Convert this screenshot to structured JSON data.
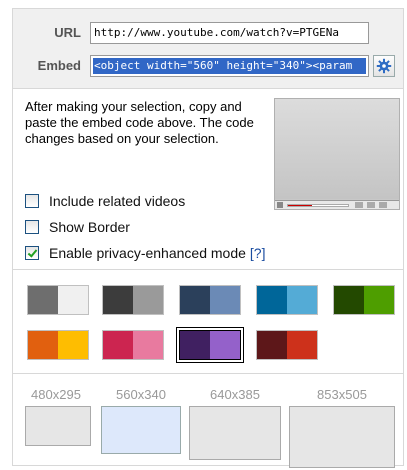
{
  "top": {
    "url_label": "URL",
    "url_value": "http://www.youtube.com/watch?v=PTGENa",
    "embed_label": "Embed",
    "embed_value": "<object width=\"560\" height=\"340\"><param"
  },
  "gear_icon": "gear-icon",
  "description": "After making your selection, copy and paste the embed code above. The code changes based on your selection.",
  "options": {
    "related": {
      "label": "Include related videos",
      "checked": false
    },
    "border": {
      "label": "Show Border",
      "checked": false
    },
    "privacy": {
      "label": "Enable privacy-enhanced mode",
      "help": "[?]",
      "checked": true
    }
  },
  "color_schemes": [
    {
      "left": "#6e6e6e",
      "right": "#f0f0f0",
      "selected": false
    },
    {
      "left": "#3c3c3c",
      "right": "#9a9a9a",
      "selected": false
    },
    {
      "left": "#2b405b",
      "right": "#6b8ab6",
      "selected": false
    },
    {
      "left": "#006699",
      "right": "#54abd6",
      "selected": false
    },
    {
      "left": "#234900",
      "right": "#4e9e00",
      "selected": false
    },
    {
      "left": "#e1600f",
      "right": "#febd01",
      "selected": false
    },
    {
      "left": "#cc2550",
      "right": "#e87a9f",
      "selected": false
    },
    {
      "left": "#402061",
      "right": "#9461ca",
      "selected": true
    },
    {
      "left": "#5d1719",
      "right": "#cd311b",
      "selected": false
    }
  ],
  "sizes": [
    {
      "label": "480x295",
      "selected": false
    },
    {
      "label": "560x340",
      "selected": true
    },
    {
      "label": "640x385",
      "selected": false
    },
    {
      "label": "853x505",
      "selected": false
    }
  ]
}
